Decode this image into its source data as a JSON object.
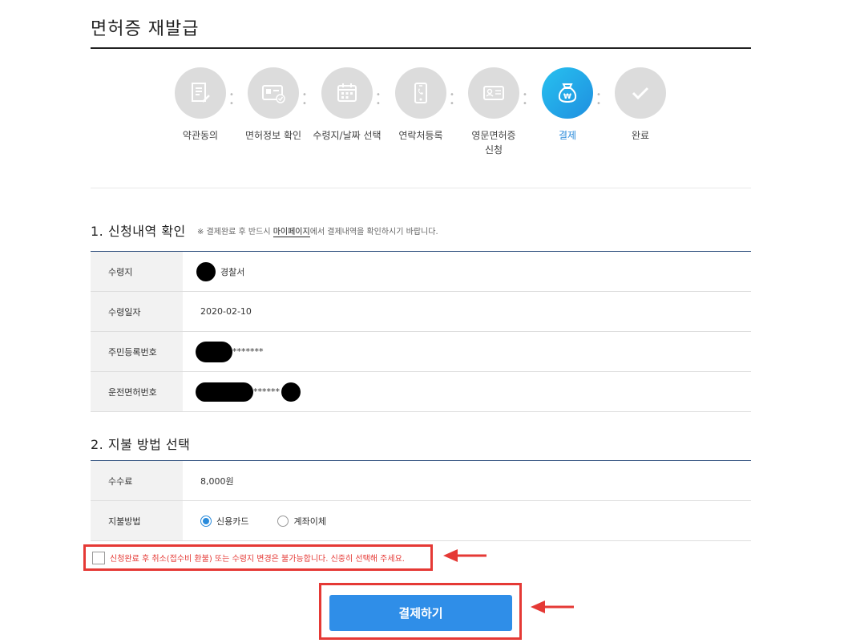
{
  "page": {
    "title": "면허증 재발급"
  },
  "steps": [
    {
      "label": "약관동의",
      "icon": "document-pen-icon",
      "active": false
    },
    {
      "label": "면허정보 확인",
      "icon": "id-card-check-icon",
      "active": false
    },
    {
      "label": "수령지/날짜 선택",
      "icon": "calendar-icon",
      "active": false
    },
    {
      "label": "연락처등록",
      "icon": "phone-icon",
      "active": false
    },
    {
      "label": "영문면허증\n신청",
      "icon": "license-card-icon",
      "active": false
    },
    {
      "label": "결제",
      "icon": "won-bag-icon",
      "active": true
    },
    {
      "label": "완료",
      "icon": "checkmark-icon",
      "active": false
    }
  ],
  "section1": {
    "title": "1. 신청내역 확인",
    "notice_prefix": "※ 결제완료 후 반드시 ",
    "notice_link": "마이페이지",
    "notice_suffix": "에서 결제내역을 확인하시기 바랍니다.",
    "rows": [
      {
        "label": "수령지",
        "value": "경찰서"
      },
      {
        "label": "수령일자",
        "value": "2020-02-10"
      },
      {
        "label": "주민등록번호",
        "value": "*******"
      },
      {
        "label": "운전면허번호",
        "value": "******"
      }
    ]
  },
  "section2": {
    "title": "2. 지불 방법 선택",
    "fee_label": "수수료",
    "fee_value": "8,000원",
    "method_label": "지불방법",
    "options": [
      {
        "label": "신용카드",
        "selected": true
      },
      {
        "label": "계좌이체",
        "selected": false
      }
    ]
  },
  "agreement": {
    "text": "신청완료 후 취소(접수비 환불) 또는 수령지 변경은 불가능합니다. 신중히 선택해 주세요.",
    "checked": false
  },
  "pay_button": {
    "label": "결제하기"
  },
  "colors": {
    "accent": "#2f8ee8",
    "active_step": "#2a8bdb",
    "highlight": "#e53935",
    "table_border": "#2c4d7c"
  }
}
